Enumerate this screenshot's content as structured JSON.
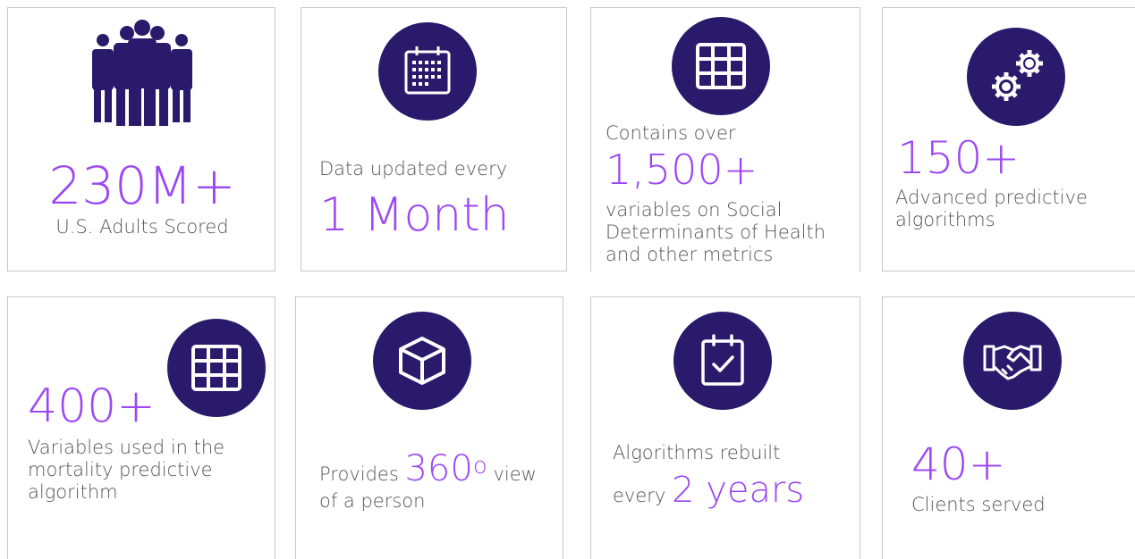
{
  "colors": {
    "accent": "#9b47f5",
    "icon_bg": "#2a1a6b",
    "text": "#555555",
    "border": "#c9c9c9"
  },
  "cards": [
    {
      "icon": "people-group-icon",
      "stat": "230M+",
      "caption": "U.S. Adults Scored"
    },
    {
      "icon": "calendar-icon",
      "prefix": "Data updated every",
      "stat": "1 Month"
    },
    {
      "icon": "grid-table-icon",
      "prefix": "Contains over",
      "stat": "1,500+",
      "caption_lines": [
        "variables on Social",
        "Determinants of Health",
        "and other metrics"
      ]
    },
    {
      "icon": "gears-icon",
      "stat": "150+",
      "caption_lines": [
        "Advanced predictive",
        "algorithms"
      ]
    },
    {
      "icon": "grid-table-icon",
      "stat": "400+",
      "caption_lines": [
        "Variables used in the",
        "mortality predictive",
        "algorithm"
      ]
    },
    {
      "icon": "cube-icon",
      "prefix": "Provides",
      "stat": "360",
      "stat_sup": "o",
      "suffix": "view",
      "line2": "of a person"
    },
    {
      "icon": "calendar-check-icon",
      "prefix": "Algorithms rebuilt",
      "line2_prefix": "every",
      "stat": "2 years"
    },
    {
      "icon": "handshake-icon",
      "stat": "40+",
      "caption": "Clients served"
    }
  ]
}
